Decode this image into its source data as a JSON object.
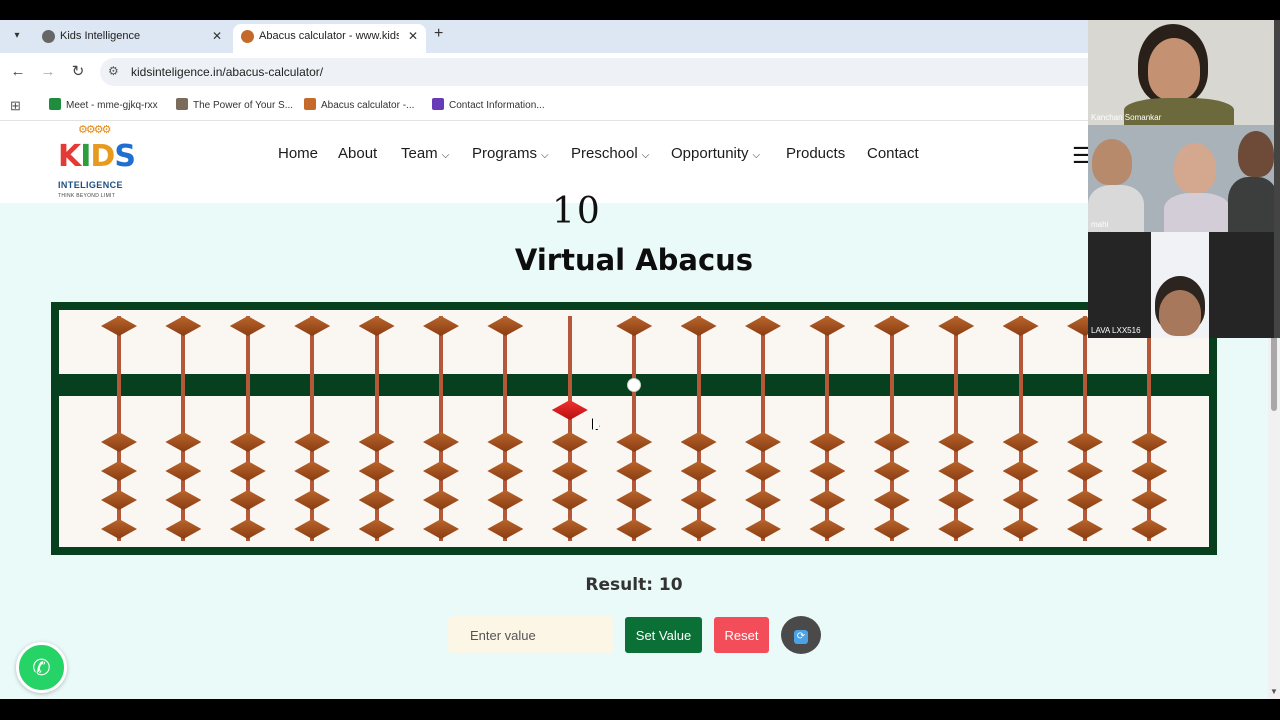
{
  "browser": {
    "tabs": [
      {
        "title": "Kids Intelligence",
        "active": false
      },
      {
        "title": "Abacus calculator - www.kidsint",
        "active": true
      }
    ],
    "url": "kidsinteligence.in/abacus-calculator/",
    "bookmarks": [
      {
        "label": "Meet - mme-gjkq-rxx",
        "color": "#1e8e3e"
      },
      {
        "label": "The Power of Your S...",
        "color": "#7a6b5a"
      },
      {
        "label": "Abacus calculator -...",
        "color": "#c46b2b"
      },
      {
        "label": "Contact Information...",
        "color": "#673ab7"
      }
    ]
  },
  "site": {
    "logo": {
      "text": "KIDS",
      "brand": "INTELIGENCE",
      "tagline": "THINK BEYOND LIMIT"
    },
    "nav": [
      {
        "label": "Home",
        "dropdown": false
      },
      {
        "label": "About",
        "dropdown": false
      },
      {
        "label": "Team",
        "dropdown": true
      },
      {
        "label": "Programs",
        "dropdown": true
      },
      {
        "label": "Preschool",
        "dropdown": true
      },
      {
        "label": "Opportunity",
        "dropdown": true
      },
      {
        "label": "Products",
        "dropdown": false
      },
      {
        "label": "Contact",
        "dropdown": false
      }
    ]
  },
  "scribble": "10",
  "heading": "Virtual Abacus",
  "abacus": {
    "rods": 17,
    "lower_beads_per_rod": 4,
    "active_rod": 7,
    "active_bead": "upper",
    "unit_rod": 8
  },
  "result": "Result: 10",
  "controls": {
    "input_placeholder": "Enter value",
    "set_label": "Set Value",
    "reset_label": "Reset",
    "refresh_icon": "refresh-icon"
  },
  "meeting": {
    "participants": [
      "Kanchan Somankar",
      "mahi",
      "LAVA LXX516"
    ]
  },
  "colors": {
    "frame": "#07401f",
    "bead": "#a5501e",
    "active_bead": "#e02020",
    "set_button": "#0a7036",
    "reset_button": "#f24d58"
  }
}
